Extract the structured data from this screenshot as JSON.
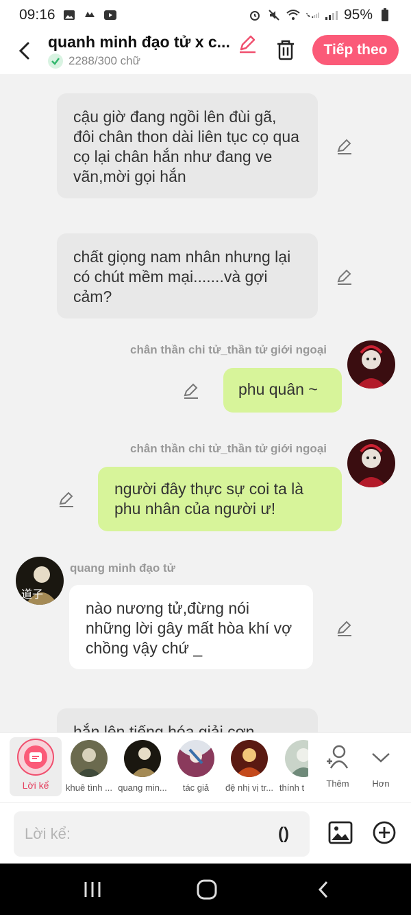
{
  "status_bar": {
    "time": "09:16",
    "battery": "95%"
  },
  "header": {
    "title": "quanh minh đạo tử x c...",
    "word_count": "2288/300 chữ",
    "next_label": "Tiếp theo",
    "accent_color": "#fb5a78"
  },
  "messages": [
    {
      "type": "narration",
      "text": "cậu giờ đang ngồi lên đùi gã, đôi chân thon dài liên tục cọ qua cọ lại chân hắn như đang ve vãn,mời gọi hắn"
    },
    {
      "type": "narration",
      "text": "chất giọng nam nhân nhưng lại có chút mềm mại.......và gợi cảm?"
    },
    {
      "type": "right",
      "sender": "chân thần chi tử_thần tử giới ngoại",
      "text": "phu quân ~"
    },
    {
      "type": "right",
      "sender": "chân thần chi tử_thần tử giới ngoại",
      "text": "người đây thực sự coi ta là phu nhân của người ư!"
    },
    {
      "type": "left",
      "sender": "quang minh đạo tử",
      "text": "nào nương tử,đừng nói những lời gây mất hòa khí vợ chồng vậy chứ _"
    },
    {
      "type": "narration",
      "text": "hắn lên tiếng hóa giải cơn"
    }
  ],
  "characters": {
    "narrator_label": "Lời kể",
    "items": [
      "khuê tình ...",
      "quang min...",
      "tác giả",
      "đệ nhị vị tr...",
      "thính t"
    ],
    "more_label": "Thêm",
    "collapse_label": "Hơn"
  },
  "input": {
    "placeholder": "Lời kể:",
    "paren_label": "()"
  }
}
